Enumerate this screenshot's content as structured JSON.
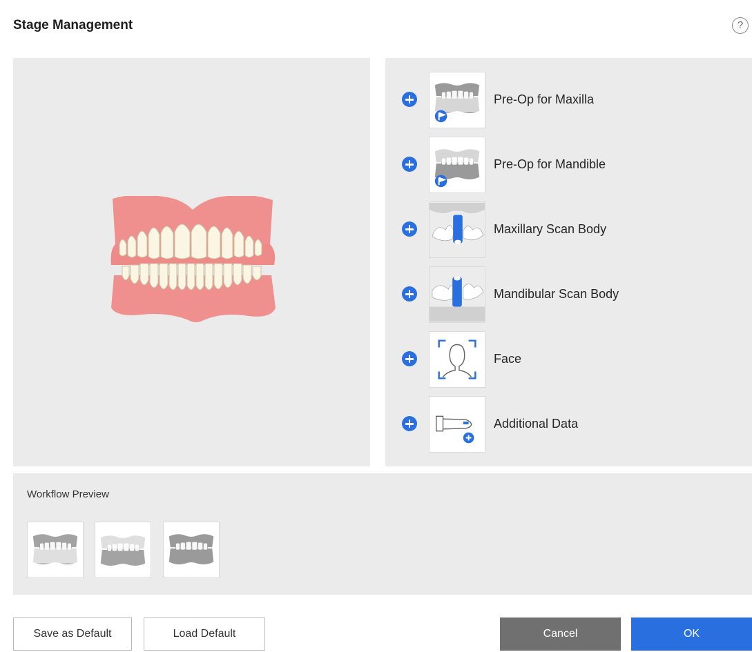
{
  "dialog": {
    "title": "Stage Management",
    "help_label": "?"
  },
  "stages": [
    {
      "label": "Pre-Op for Maxilla",
      "icon": "maxilla-teeth-icon"
    },
    {
      "label": "Pre-Op for Mandible",
      "icon": "mandible-teeth-icon"
    },
    {
      "label": "Maxillary Scan Body",
      "icon": "maxillary-scan-body-icon"
    },
    {
      "label": "Mandibular Scan Body",
      "icon": "mandibular-scan-body-icon"
    },
    {
      "label": "Face",
      "icon": "face-scan-icon"
    },
    {
      "label": "Additional Data",
      "icon": "additional-data-icon"
    }
  ],
  "workflow": {
    "title": "Workflow Preview",
    "items": [
      "maxilla-stage-icon",
      "mandible-stage-icon",
      "occlusion-stage-icon"
    ]
  },
  "footer": {
    "save_default": "Save as Default",
    "load_default": "Load Default",
    "cancel": "Cancel",
    "ok": "OK"
  },
  "colors": {
    "accent": "#2a6fe0",
    "cancel": "#707070",
    "panel": "#ebebeb",
    "gum": "#f0908e",
    "tooth": "#fbf6e3"
  }
}
